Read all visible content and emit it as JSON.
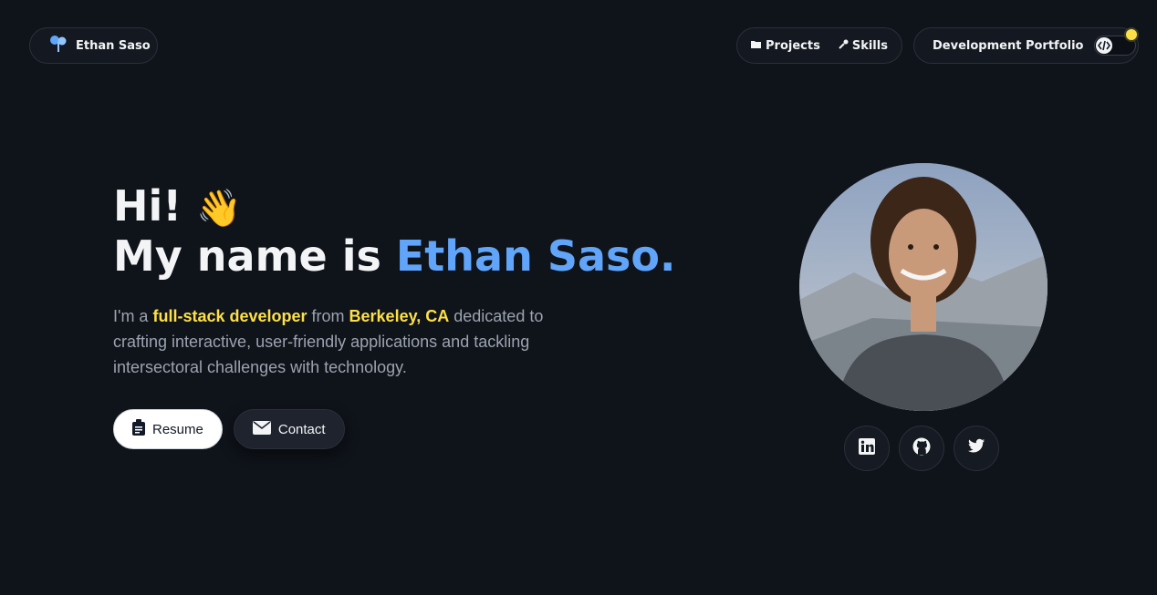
{
  "brand": {
    "name": "Ethan Saso",
    "icon": "tree-icon"
  },
  "nav": {
    "items": [
      {
        "label": "Projects",
        "icon": "folder-icon"
      },
      {
        "label": "Skills",
        "icon": "wrench-icon"
      }
    ]
  },
  "mode": {
    "label": "Development Portfolio",
    "toggle_icon": "code-icon",
    "indicator_color": "#fde047"
  },
  "hero": {
    "greeting": "Hi!",
    "wave_emoji": "👋",
    "name_prefix": "My name is ",
    "name": "Ethan Saso.",
    "bio": {
      "t1": "I'm a ",
      "h1": "full-stack developer",
      "t2": " from ",
      "h2": "Berkeley, CA",
      "t3": " dedicated to crafting interactive, user-friendly applications and tackling intersectoral challenges with technology."
    }
  },
  "buttons": {
    "resume": {
      "label": "Resume",
      "icon": "clipboard-icon"
    },
    "contact": {
      "label": "Contact",
      "icon": "envelope-icon"
    }
  },
  "socials": [
    {
      "name": "linkedin",
      "icon": "linkedin-icon"
    },
    {
      "name": "github",
      "icon": "github-icon"
    },
    {
      "name": "twitter",
      "icon": "twitter-icon"
    }
  ],
  "colors": {
    "background": "#0f131a",
    "accent_blue": "#60a5fa",
    "accent_yellow": "#fde047"
  }
}
